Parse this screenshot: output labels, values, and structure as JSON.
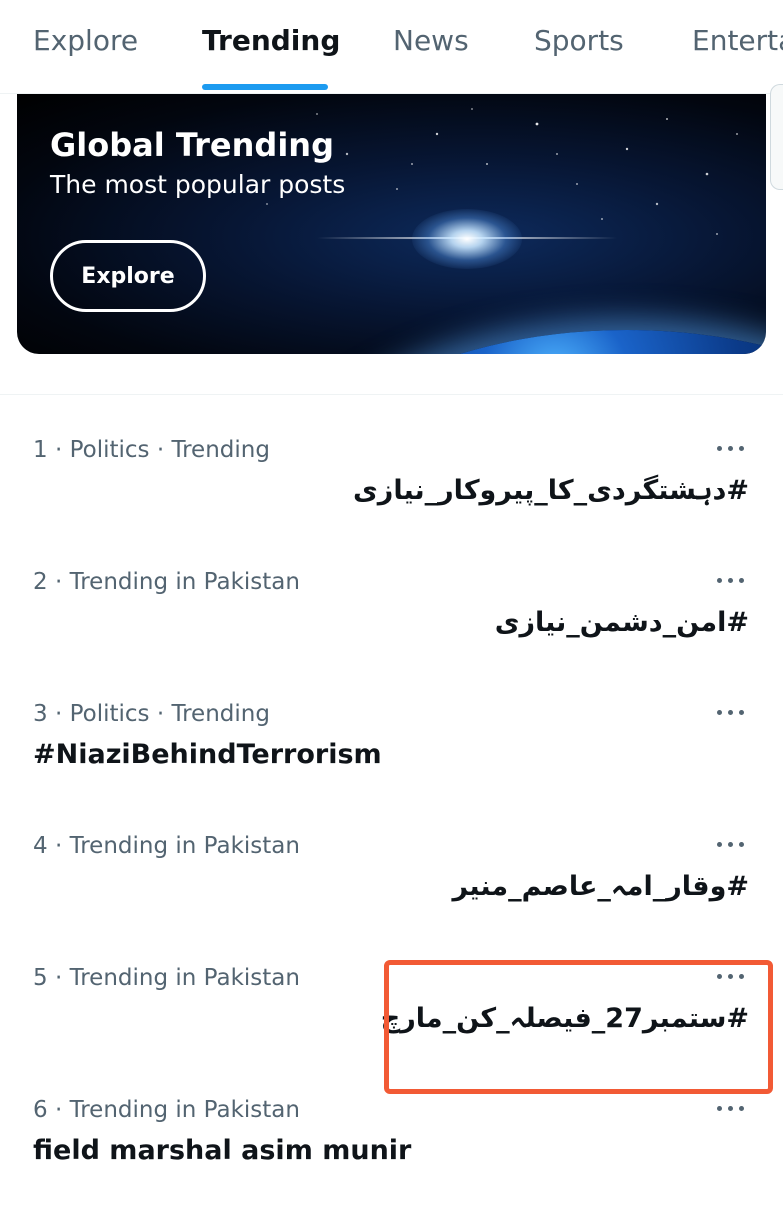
{
  "tabs": [
    {
      "label": "Explore",
      "active": false
    },
    {
      "label": "Trending",
      "active": true
    },
    {
      "label": "News",
      "active": false
    },
    {
      "label": "Sports",
      "active": false
    },
    {
      "label": "Enterta",
      "active": false
    }
  ],
  "banner": {
    "title": "Global Trending",
    "subtitle": "The most popular posts",
    "button_label": "Explore"
  },
  "trends": [
    {
      "meta": "1 · Politics · Trending",
      "title": "#دہشتگردی_کا_پیروکار_نیازی",
      "rtl": true
    },
    {
      "meta": "2 · Trending in Pakistan",
      "title": "#امن_دشمن_نیازی",
      "rtl": true
    },
    {
      "meta": "3 · Politics · Trending",
      "title": "#NiaziBehindTerrorism",
      "rtl": false
    },
    {
      "meta": "4 · Trending in Pakistan",
      "title": "#وقار_امہ_عاصم_منیر",
      "rtl": true
    },
    {
      "meta": "5 · Trending in Pakistan",
      "title": "#ستمبر27_فیصلہ_کن_مارچ",
      "rtl": true
    },
    {
      "meta": "6 · Trending in Pakistan",
      "title": "field marshal asim munir",
      "rtl": false
    }
  ],
  "colors": {
    "accent": "#1d9bf0",
    "highlight": "#f25a35",
    "secondary_text": "#536471"
  },
  "icons": {
    "more": "more-horizontal-icon"
  }
}
